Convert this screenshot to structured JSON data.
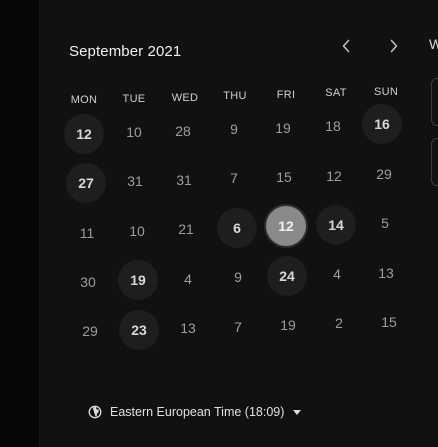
{
  "calendar": {
    "month_label": "September 2021",
    "nav": {
      "prev_icon": "chevron-left-icon",
      "next_icon": "chevron-right-icon"
    },
    "weekdays": [
      "MON",
      "TUE",
      "WED",
      "THU",
      "FRI",
      "SAT",
      "SUN"
    ],
    "weeks": [
      [
        {
          "d": "12",
          "state": "available"
        },
        {
          "d": "10",
          "state": "disabled"
        },
        {
          "d": "28",
          "state": "disabled"
        },
        {
          "d": "9",
          "state": "disabled"
        },
        {
          "d": "19",
          "state": "disabled"
        },
        {
          "d": "18",
          "state": "disabled"
        },
        {
          "d": "16",
          "state": "available"
        }
      ],
      [
        {
          "d": "27",
          "state": "available"
        },
        {
          "d": "31",
          "state": "disabled"
        },
        {
          "d": "31",
          "state": "disabled"
        },
        {
          "d": "7",
          "state": "disabled"
        },
        {
          "d": "15",
          "state": "disabled"
        },
        {
          "d": "12",
          "state": "disabled"
        },
        {
          "d": "29",
          "state": "disabled"
        }
      ],
      [
        {
          "d": "11",
          "state": "disabled"
        },
        {
          "d": "10",
          "state": "disabled"
        },
        {
          "d": "21",
          "state": "disabled"
        },
        {
          "d": "6",
          "state": "available"
        },
        {
          "d": "12",
          "state": "selected"
        },
        {
          "d": "14",
          "state": "available"
        },
        {
          "d": "5",
          "state": "disabled"
        }
      ],
      [
        {
          "d": "30",
          "state": "disabled"
        },
        {
          "d": "19",
          "state": "available"
        },
        {
          "d": "4",
          "state": "disabled"
        },
        {
          "d": "9",
          "state": "disabled"
        },
        {
          "d": "24",
          "state": "available"
        },
        {
          "d": "4",
          "state": "disabled"
        },
        {
          "d": "13",
          "state": "disabled"
        }
      ],
      [
        {
          "d": "29",
          "state": "disabled"
        },
        {
          "d": "23",
          "state": "available"
        },
        {
          "d": "13",
          "state": "disabled"
        },
        {
          "d": "7",
          "state": "disabled"
        },
        {
          "d": "19",
          "state": "disabled"
        },
        {
          "d": "2",
          "state": "disabled"
        },
        {
          "d": "15",
          "state": "disabled"
        }
      ]
    ]
  },
  "timezone": {
    "icon": "globe-icon",
    "label": "Eastern European Time (18:09)",
    "caret_icon": "caret-down-icon"
  },
  "right_panel": {
    "partial_heading": "W"
  },
  "colors": {
    "background": "#111111",
    "available_day_bg": "#1e1e1e",
    "selected_day_bg": "#8a8a8a",
    "disabled_text": "#9d9d9d"
  }
}
